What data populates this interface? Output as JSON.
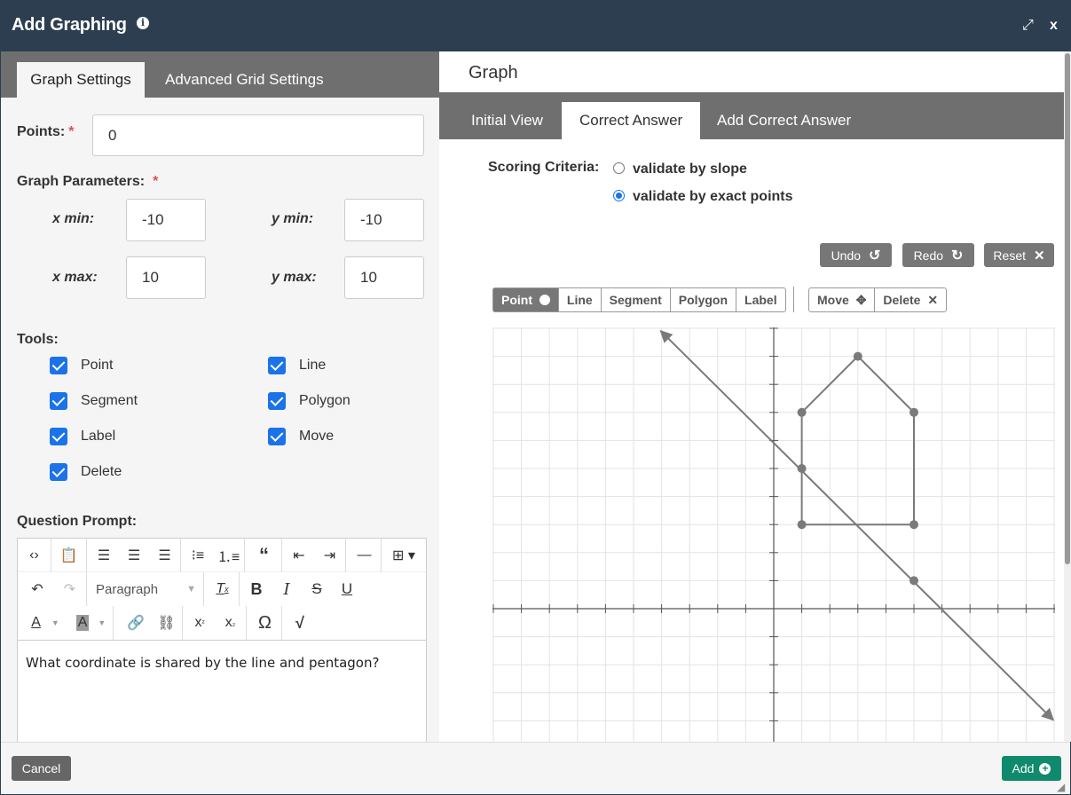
{
  "window": {
    "title": "Add Graphing",
    "expand_icon": "expand-icon",
    "close_label": "x"
  },
  "left": {
    "tabs": [
      {
        "label": "Graph Settings"
      },
      {
        "label": "Advanced Grid Settings"
      }
    ],
    "points_label": "Points:",
    "points_value": "0",
    "params_label": "Graph Parameters:",
    "xmin_label": "x min:",
    "xmin": "-10",
    "ymin_label": "y min:",
    "ymin": "-10",
    "xmax_label": "x max:",
    "xmax": "10",
    "ymax_label": "y max:",
    "ymax": "10",
    "tools_label": "Tools:",
    "tools": [
      {
        "label": "Point",
        "checked": true
      },
      {
        "label": "Line",
        "checked": true
      },
      {
        "label": "Segment",
        "checked": true
      },
      {
        "label": "Polygon",
        "checked": true
      },
      {
        "label": "Label",
        "checked": true
      },
      {
        "label": "Move",
        "checked": true
      },
      {
        "label": "Delete",
        "checked": true
      }
    ],
    "prompt_label": "Question Prompt:",
    "editor": {
      "format_select": "Paragraph",
      "content": "What coordinate is shared by the line and pentagon?"
    }
  },
  "right": {
    "header": "Graph",
    "tabs": [
      {
        "label": "Initial View"
      },
      {
        "label": "Correct Answer"
      },
      {
        "label": "Add Correct Answer"
      }
    ],
    "scoring_label": "Scoring Criteria:",
    "options": [
      {
        "label": "validate by slope",
        "selected": false
      },
      {
        "label": "validate by exact points",
        "selected": true
      }
    ],
    "actions": {
      "undo": "Undo",
      "redo": "Redo",
      "reset": "Reset"
    },
    "tools": {
      "point": "Point",
      "line": "Line",
      "segment": "Segment",
      "polygon": "Polygon",
      "label": "Label",
      "move": "Move",
      "delete": "Delete"
    }
  },
  "graph": {
    "xlim": [
      -10,
      10
    ],
    "ylim": [
      -10,
      10
    ],
    "line_points": [
      [
        1,
        5
      ],
      [
        5,
        1
      ]
    ],
    "line_direction": "extends both ways",
    "polygon": [
      [
        3,
        9
      ],
      [
        5,
        7
      ],
      [
        5,
        3
      ],
      [
        1,
        3
      ],
      [
        1,
        7
      ]
    ]
  },
  "footer": {
    "cancel": "Cancel",
    "add": "Add"
  },
  "colors": {
    "titlebar": "#2d3e50",
    "tab_bar": "#6f6f6f",
    "checkbox": "#1a73e8",
    "add_button": "#0f8a6c",
    "graph_stroke": "#7a7a7a"
  }
}
